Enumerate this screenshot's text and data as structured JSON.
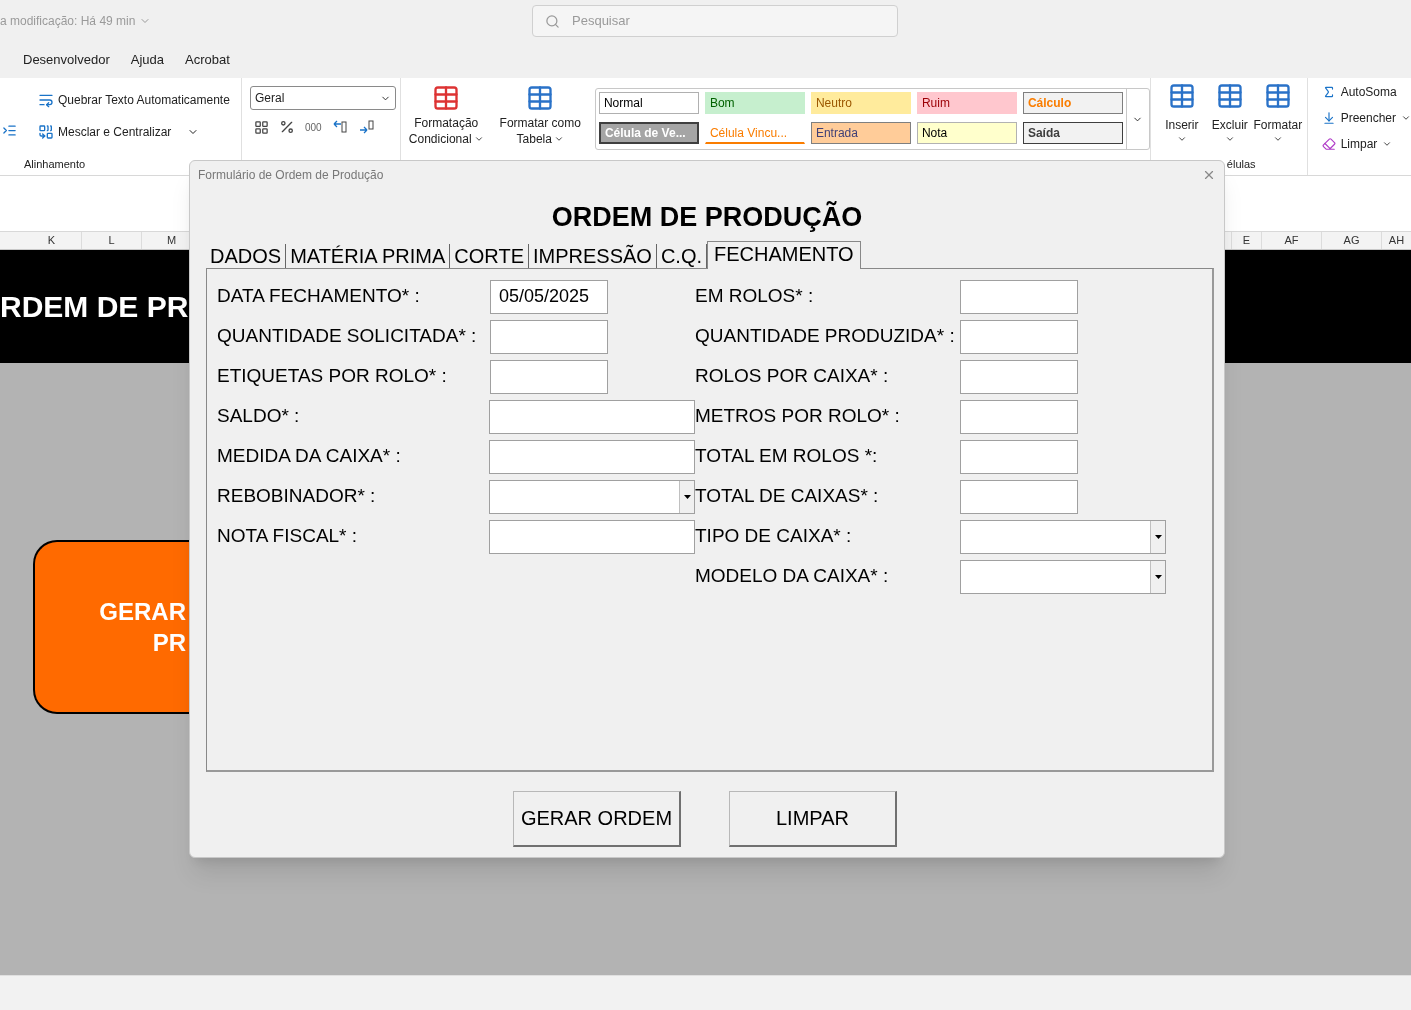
{
  "title_bar": {
    "modified": "a modificação: Há 49 min",
    "search": {
      "placeholder": "Pesquisar"
    }
  },
  "menu": [
    "Desenvolvedor",
    "Ajuda",
    "Acrobat"
  ],
  "ribbon": {
    "alignment": {
      "wrap": "Quebrar Texto Automaticamente",
      "merge": "Mesclar e Centralizar",
      "label": "Alinhamento"
    },
    "number": {
      "format": "Geral",
      "thousands": "000"
    },
    "styles": {
      "buttons": [
        [
          "Formatação",
          "Condicional"
        ],
        [
          "Formatar como",
          "Tabela"
        ]
      ],
      "gallery": [
        {
          "label": "Normal",
          "kind": "normal",
          "color": "#ffffff"
        },
        {
          "label": "Bom",
          "kind": "good",
          "color": "#c6efce"
        },
        {
          "label": "Neutro",
          "kind": "neutral",
          "color": "#ffeb9c"
        },
        {
          "label": "Ruim",
          "kind": "bad",
          "color": "#ffc7ce"
        },
        {
          "label": "Cálculo",
          "kind": "calculation",
          "color": "#f2f2f2"
        },
        {
          "label": "Célula de Ve...",
          "kind": "check",
          "color": "#a5a5a5"
        },
        {
          "label": "Célula Vincu...",
          "kind": "linked",
          "color": "#ffffff"
        },
        {
          "label": "Entrada",
          "kind": "input",
          "color": "#ffcc99"
        },
        {
          "label": "Nota",
          "kind": "note",
          "color": "#ffffcc"
        },
        {
          "label": "Saída",
          "kind": "output",
          "color": "#f2f2f2"
        }
      ]
    },
    "cells": {
      "buttons": [
        "Inserir",
        "Excluir",
        "Formatar"
      ],
      "label": "élulas"
    },
    "editing": [
      "AutoSoma",
      "Preencher",
      "Limpar"
    ]
  },
  "columns_left": [
    "K",
    "L",
    "M"
  ],
  "columns_right": [
    "E",
    "AF",
    "AG",
    "AH"
  ],
  "sheet": {
    "banner": "RDEM DE PR",
    "button_lines": [
      "GERAR",
      "PR"
    ]
  },
  "dialog": {
    "title": "Formulário de Ordem de Produção",
    "heading": "ORDEM DE PRODUÇÃO",
    "tabs": [
      {
        "label": "DADOS",
        "selected": false
      },
      {
        "label": "MATÉRIA PRIMA",
        "selected": false
      },
      {
        "label": "CORTE",
        "selected": false
      },
      {
        "label": "IMPRESSÃO",
        "selected": false
      },
      {
        "label": "C.Q.",
        "selected": false
      },
      {
        "label": "FECHAMENTO",
        "selected": true
      }
    ],
    "fields_left": [
      {
        "label": "DATA FECHAMENTO* :",
        "kind": "short",
        "value": "05/05/2025"
      },
      {
        "label": "QUANTIDADE SOLICITADA* :",
        "kind": "short"
      },
      {
        "label": "ETIQUETAS POR ROLO* :",
        "kind": "short"
      },
      {
        "label": "SALDO* :",
        "kind": "long"
      },
      {
        "label": "MEDIDA DA CAIXA* :",
        "kind": "long"
      },
      {
        "label": "REBOBINADOR* :",
        "kind": "dropdown"
      },
      {
        "label": "NOTA FISCAL* :",
        "kind": "long"
      }
    ],
    "fields_right": [
      {
        "label": "EM ROLOS* :",
        "kind": "short"
      },
      {
        "label": "QUANTIDADE PRODUZIDA* :",
        "kind": "short"
      },
      {
        "label": "ROLOS POR CAIXA* :",
        "kind": "short"
      },
      {
        "label": "METROS POR ROLO* :",
        "kind": "short"
      },
      {
        "label": "TOTAL EM ROLOS *:",
        "kind": "short"
      },
      {
        "label": "TOTAL DE CAIXAS* :",
        "kind": "short"
      },
      {
        "label": "TIPO DE CAIXA* :",
        "kind": "dropdown"
      },
      {
        "label": "MODELO DA CAIXA* :",
        "kind": "dropdown"
      }
    ],
    "buttons": [
      "GERAR ORDEM",
      "LIMPAR"
    ]
  }
}
